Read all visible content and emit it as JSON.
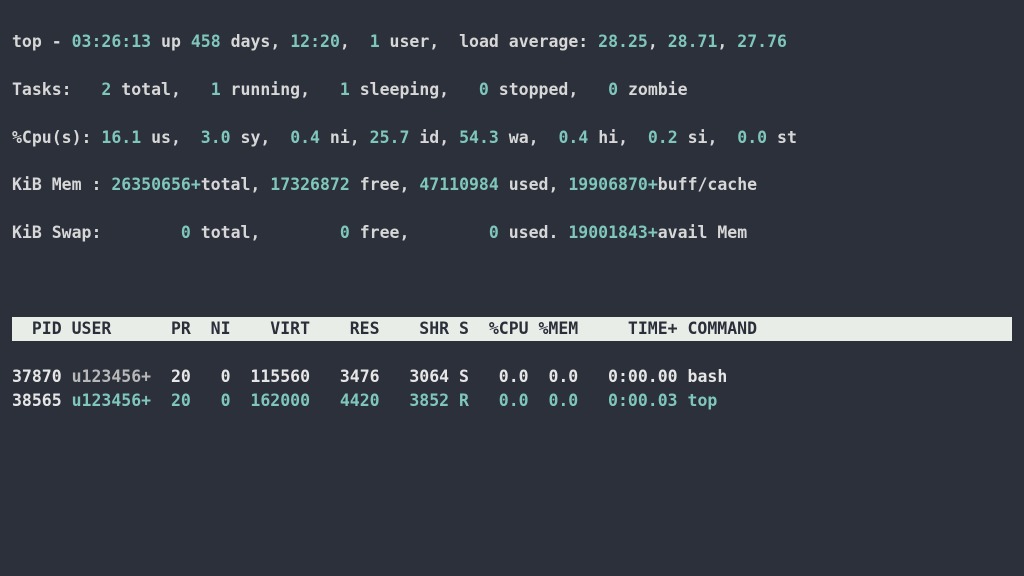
{
  "summary": {
    "top_prefix": "top - ",
    "time": "03:26:13",
    "up_prefix": " up ",
    "up_days": "458",
    "up_days_suffix": " days, ",
    "up_hm": "12:20",
    "users_sep": ",  ",
    "users_count": "1",
    "users_label": " user,  load average: ",
    "load1": "28.25",
    "comma": ", ",
    "load5": "28.71",
    "load15": "27.76"
  },
  "tasks": {
    "label": "Tasks:   ",
    "total": "2",
    "total_lbl": " total,   ",
    "running": "1",
    "running_lbl": " running,   ",
    "sleeping": "1",
    "sleeping_lbl": " sleeping,   ",
    "stopped": "0",
    "stopped_lbl": " stopped,   ",
    "zombie": "0",
    "zombie_lbl": " zombie"
  },
  "cpu": {
    "label": "%Cpu(s): ",
    "us": "16.1",
    "us_lbl": " us,  ",
    "sy": "3.0",
    "sy_lbl": " sy,  ",
    "ni": "0.4",
    "ni_lbl": " ni, ",
    "id": "25.7",
    "id_lbl": " id, ",
    "wa": "54.3",
    "wa_lbl": " wa,  ",
    "hi": "0.4",
    "hi_lbl": " hi,  ",
    "si": "0.2",
    "si_lbl": " si,  ",
    "st": "0.0",
    "st_lbl": " st"
  },
  "mem": {
    "label": "KiB Mem : ",
    "total": "26350656+",
    "total_lbl": "total, ",
    "free": "17326872",
    "free_lbl": " free, ",
    "used": "47110984",
    "used_lbl": " used, ",
    "buff": "19906870+",
    "buff_lbl": "buff/cache"
  },
  "swap": {
    "label": "KiB Swap:        ",
    "total": "0",
    "total_lbl": " total,        ",
    "free": "0",
    "free_lbl": " free,        ",
    "used": "0",
    "used_lbl": " used. ",
    "avail": "19001843+",
    "avail_lbl": "avail Mem"
  },
  "header": "  PID USER      PR  NI    VIRT    RES    SHR S  %CPU %MEM     TIME+ COMMAND          ",
  "procs": [
    {
      "pid": "37870",
      "user": " u123456+  ",
      "rest": "20   0  115560   3476   3064 S   0.0  0.0   0:00.00 bash",
      "state": "S"
    },
    {
      "pid": "38565",
      "user": " u123456+  ",
      "rest": "20   0  162000   4420   3852 R   0.0  0.0   0:00.03 top",
      "state": "R"
    }
  ]
}
